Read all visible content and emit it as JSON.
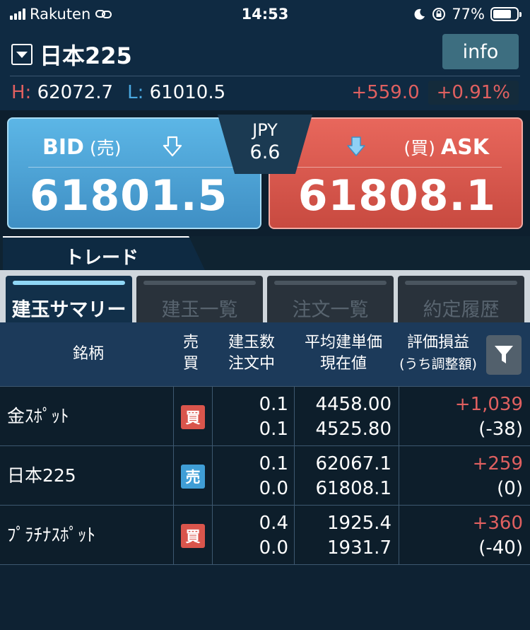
{
  "status": {
    "carrier": "Rakuten",
    "time": "14:53",
    "battery": "77%",
    "battery_level": 0.77
  },
  "header": {
    "title": "日本225",
    "info_label": "info",
    "high_label": "H:",
    "high": "62072.7",
    "low_label": "L:",
    "low": "61010.5",
    "change": "+559.0",
    "change_pct": "+0.91%"
  },
  "quote": {
    "bid_label": "BID",
    "bid_sub": "(売)",
    "bid_price": "61801.5",
    "ask_label": "ASK",
    "ask_sub": "(買)",
    "ask_price": "61808.1",
    "currency": "JPY",
    "spread": "6.6"
  },
  "tabs": {
    "trade": "トレード",
    "sub": [
      "建玉サマリー",
      "建玉一覧",
      "注文一覧",
      "約定履歴"
    ]
  },
  "table": {
    "headers": {
      "symbol": "銘柄",
      "side_1": "売",
      "side_2": "買",
      "qty_1": "建玉数",
      "qty_2": "注文中",
      "price_1": "平均建単価",
      "price_2": "現在値",
      "pl_1": "評価損益",
      "pl_2": "(うち調整額)"
    },
    "rows": [
      {
        "symbol": "金ｽﾎﾟｯﾄ",
        "side": "買",
        "qty": "0.1",
        "pending": "0.1",
        "avg_price": "4458.00",
        "current": "4525.80",
        "pl": "+1,039",
        "adj": "(-38)"
      },
      {
        "symbol": "日本225",
        "side": "売",
        "qty": "0.1",
        "pending": "0.0",
        "avg_price": "62067.1",
        "current": "61808.1",
        "pl": "+259",
        "adj": "(0)"
      },
      {
        "symbol": "ﾌﾟﾗﾁﾅｽﾎﾟｯﾄ",
        "side": "買",
        "qty": "0.4",
        "pending": "0.0",
        "avg_price": "1925.4",
        "current": "1931.7",
        "pl": "+360",
        "adj": "(-40)"
      }
    ]
  },
  "colors": {
    "bid": "#4fa6d9",
    "ask": "#d9554c",
    "positive": "#e06060",
    "active_tab_bar": "#8fd6f5"
  }
}
